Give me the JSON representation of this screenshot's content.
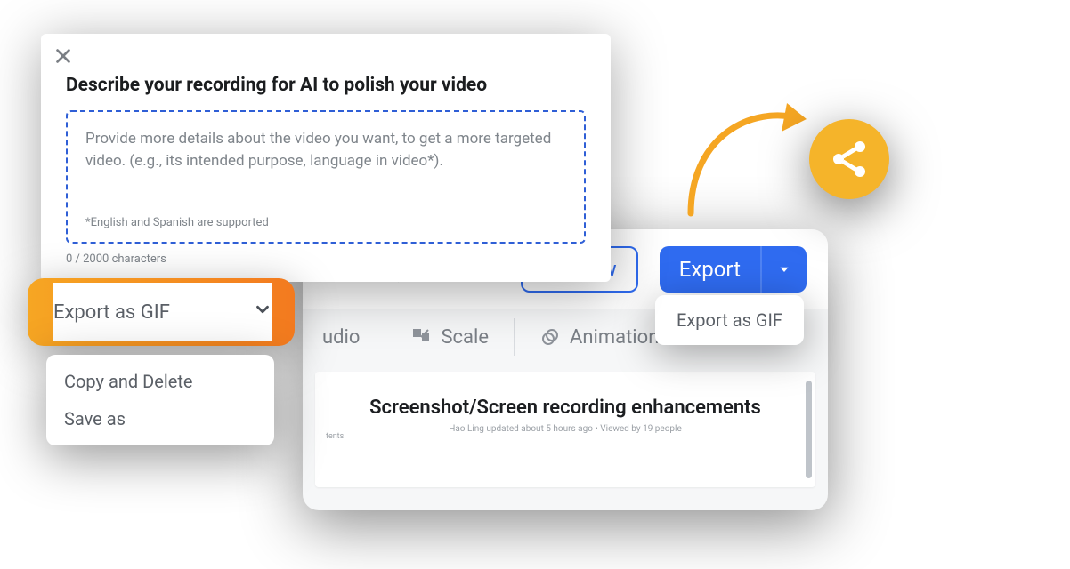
{
  "ai_card": {
    "title": "Describe your recording for AI to polish your video",
    "placeholder": "Provide more details about the video you want, to get a more targeted video. (e.g., its intended purpose, language in video*).",
    "footnote": "*English and Spanish are supported",
    "counter": "0 / 2000 characters"
  },
  "gif_dropdown": {
    "trigger": "Export as GIF",
    "items": [
      "Copy and Delete",
      "Save as"
    ]
  },
  "editor": {
    "preview": "Preview",
    "export": "Export",
    "export_option": "Export as GIF",
    "tabs": {
      "audio": "udio",
      "scale": "Scale",
      "animation": "Animation"
    },
    "doc": {
      "contents_label": "tents",
      "title": "Screenshot/Screen recording enhancements",
      "meta": "Hao Ling updated about 5 hours ago  • Viewed by 19 people"
    }
  }
}
